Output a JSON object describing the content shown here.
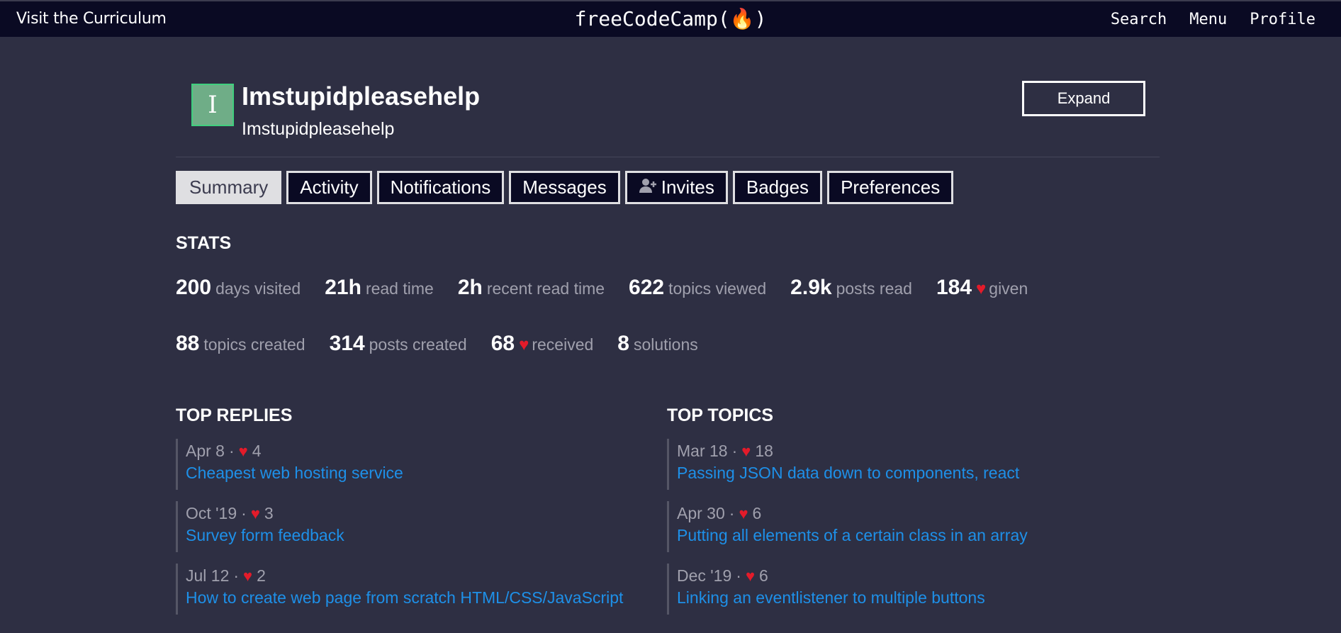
{
  "header": {
    "curriculum_link": "Visit the Curriculum",
    "logo_text": "freeCodeCamp(🔥)",
    "nav": [
      "Search",
      "Menu",
      "Profile"
    ]
  },
  "profile": {
    "avatar_letter": "I",
    "username": "Imstupidpleasehelp",
    "full_name": "Imstupidpleasehelp",
    "expand_label": "Expand"
  },
  "tabs": [
    "Summary",
    "Activity",
    "Notifications",
    "Messages",
    "Invites",
    "Badges",
    "Preferences"
  ],
  "stats": {
    "title": "STATS",
    "row1": [
      {
        "value": "200",
        "label": "days visited"
      },
      {
        "value": "21h",
        "label": "read time"
      },
      {
        "value": "2h",
        "label": "recent read time"
      },
      {
        "value": "622",
        "label": "topics viewed"
      },
      {
        "value": "2.9k",
        "label": "posts read"
      },
      {
        "value": "184",
        "label": "given"
      }
    ],
    "row2": [
      {
        "value": "88",
        "label": "topics created"
      },
      {
        "value": "314",
        "label": "posts created"
      },
      {
        "value": "68",
        "label": "received"
      },
      {
        "value": "8",
        "label": "solutions"
      }
    ]
  },
  "top_replies": {
    "title": "TOP REPLIES",
    "items": [
      {
        "date": "Apr 8",
        "likes": "4",
        "title": "Cheapest web hosting service"
      },
      {
        "date": "Oct '19",
        "likes": "3",
        "title": "Survey form feedback"
      },
      {
        "date": "Jul 12",
        "likes": "2",
        "title": "How to create web page from scratch HTML/CSS/JavaScript"
      }
    ]
  },
  "top_topics": {
    "title": "TOP TOPICS",
    "items": [
      {
        "date": "Mar 18",
        "likes": "18",
        "title": "Passing JSON data down to components, react"
      },
      {
        "date": "Apr 30",
        "likes": "6",
        "title": "Putting all elements of a certain class in an array"
      },
      {
        "date": "Dec '19",
        "likes": "6",
        "title": "Linking an eventlistener to multiple buttons"
      }
    ]
  },
  "colors": {
    "accent_link": "#1e90e8",
    "heart": "#e31b2a",
    "avatar_bg": "#6fad87"
  }
}
